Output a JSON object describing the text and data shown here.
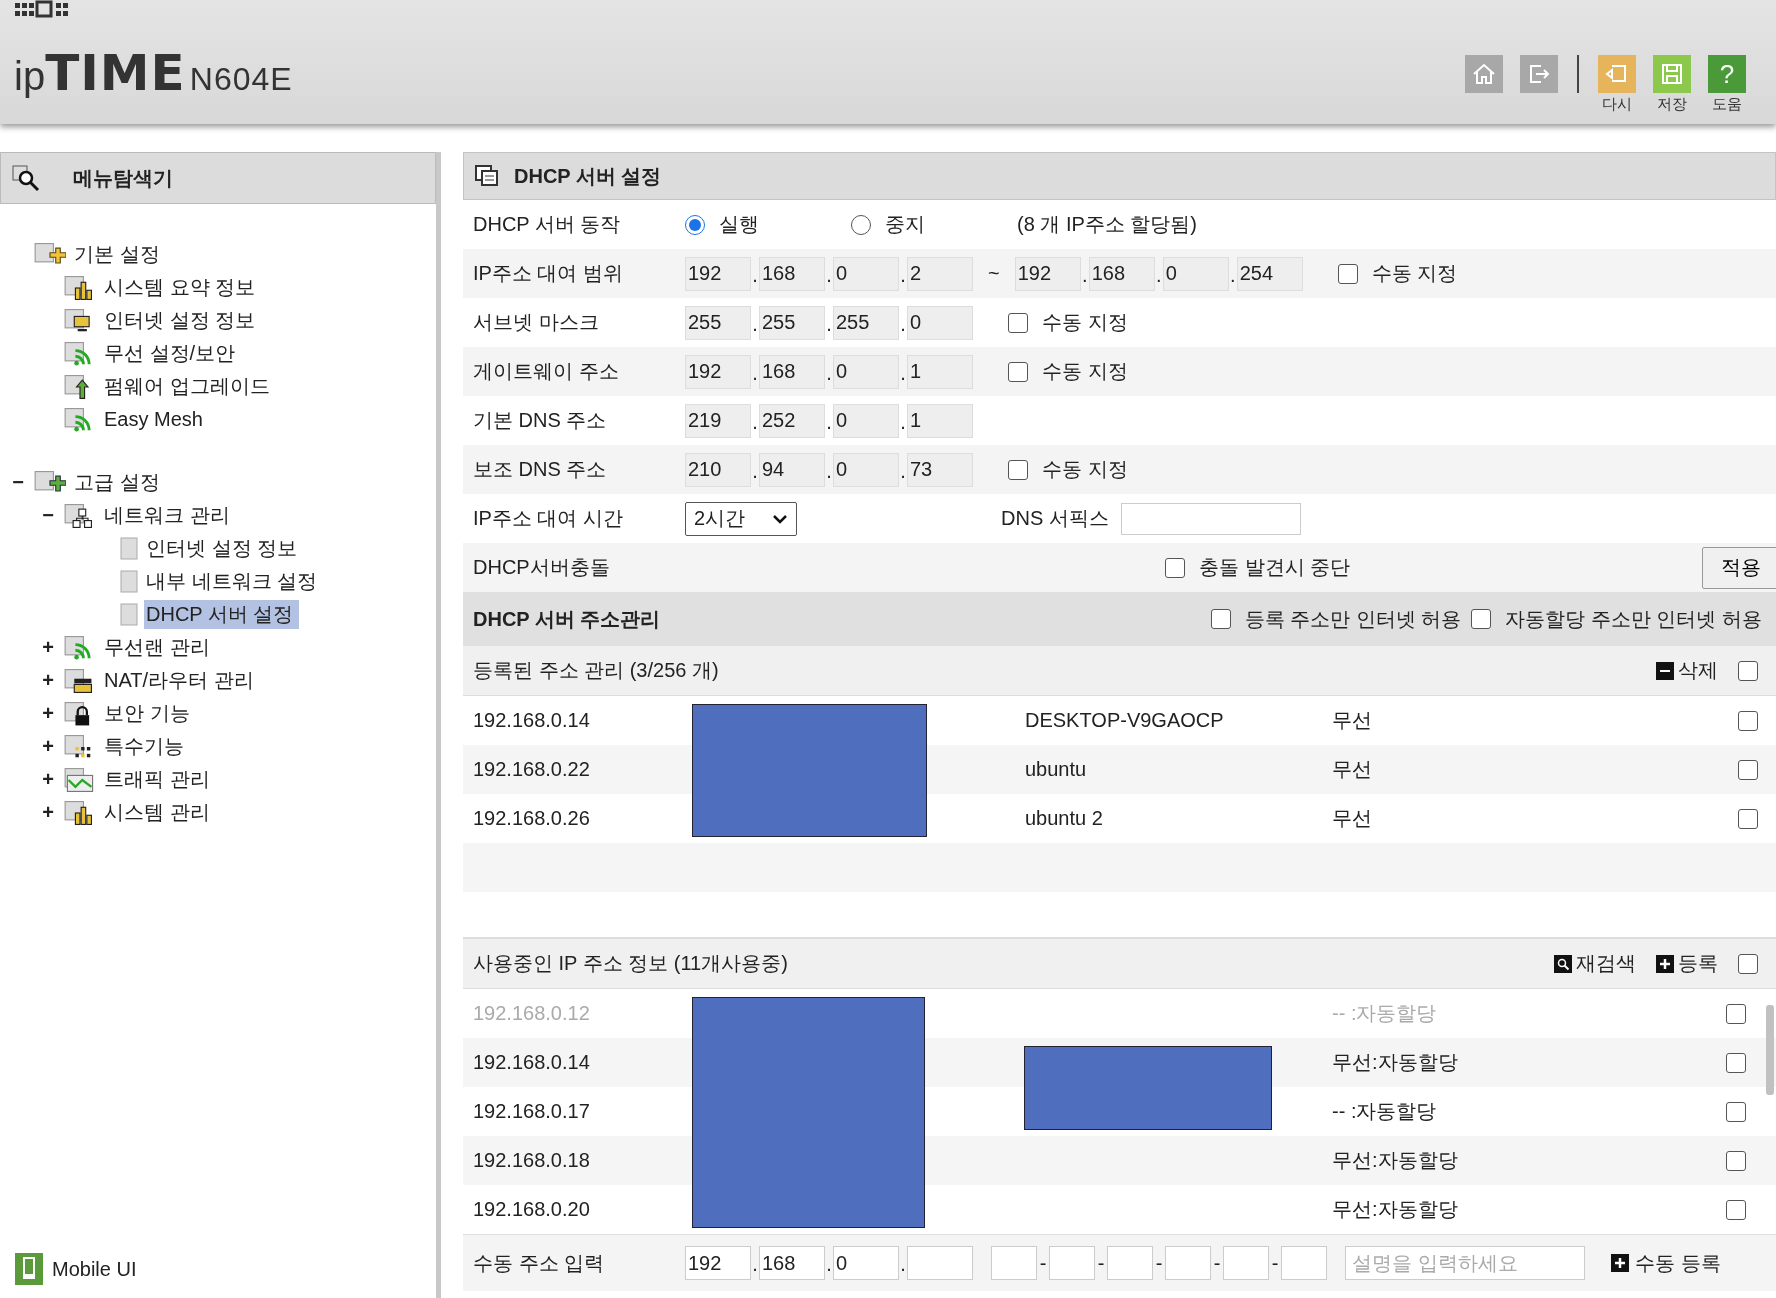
{
  "header": {
    "logo_prefix": "ip",
    "logo_main": "TIME",
    "model": "N604E",
    "toolbar": [
      {
        "kind": "home"
      },
      {
        "kind": "logout"
      },
      {
        "kind": "reload",
        "label": "다시"
      },
      {
        "kind": "save",
        "label": "저장"
      },
      {
        "kind": "help",
        "label": "도움",
        "glyph": "?"
      }
    ]
  },
  "sidebar": {
    "title": "메뉴탐색기",
    "tree": [
      {
        "label": "기본 설정",
        "kind": "folder-star",
        "selected": false,
        "children": [
          {
            "label": "시스템 요약 정보",
            "kind": "chart",
            "selected": false
          },
          {
            "label": "인터넷 설정 정보",
            "kind": "monitor",
            "selected": false
          },
          {
            "label": "무선 설정/보안",
            "kind": "wifi",
            "selected": false
          },
          {
            "label": "펌웨어 업그레이드",
            "kind": "upload",
            "selected": false
          },
          {
            "label": "Easy Mesh",
            "kind": "wifi",
            "selected": false
          }
        ]
      },
      {
        "label": "고급 설정",
        "kind": "folder-plus",
        "expanded": true,
        "selected": false,
        "children": [
          {
            "label": "네트워크 관리",
            "kind": "network",
            "expanded": true,
            "selected": false,
            "children": [
              {
                "label": "인터넷 설정 정보",
                "kind": "blank",
                "selected": false
              },
              {
                "label": "내부 네트워크 설정",
                "kind": "blank",
                "selected": false
              },
              {
                "label": "DHCP 서버 설정",
                "kind": "blank",
                "selected": true
              }
            ]
          },
          {
            "label": "무선랜 관리",
            "kind": "wifi",
            "expanded": false,
            "selected": false
          },
          {
            "label": "NAT/라우터 관리",
            "kind": "router",
            "expanded": false,
            "selected": false
          },
          {
            "label": "보안 기능",
            "kind": "lock",
            "expanded": false,
            "selected": false
          },
          {
            "label": "특수기능",
            "kind": "dots",
            "expanded": false,
            "selected": false
          },
          {
            "label": "트래픽 관리",
            "kind": "graph",
            "expanded": false,
            "selected": false
          },
          {
            "label": "시스템 관리",
            "kind": "chart",
            "expanded": false,
            "selected": false
          }
        ]
      }
    ],
    "footer": {
      "label": "Mobile UI"
    }
  },
  "main": {
    "title": "DHCP 서버 설정",
    "dot": ".",
    "toggles": {
      "expanded": "−",
      "collapsed": "+"
    },
    "form": [
      {
        "kind": "radio",
        "label": "DHCP 서버 동작",
        "options": [
          {
            "label": "실행",
            "selected": true
          },
          {
            "label": "중지",
            "selected": false
          }
        ],
        "note": "(8 개 IP주소 할당됨)"
      },
      {
        "kind": "ip",
        "label": "IP주소 대여 범위",
        "ips": [
          [
            "192",
            "168",
            "0",
            "2"
          ],
          [
            "192",
            "168",
            "0",
            "254"
          ]
        ],
        "separator": "~",
        "manual": {
          "label": "수동 지정",
          "checked": false
        }
      },
      {
        "kind": "ip",
        "label": "서브넷 마스크",
        "ips": [
          [
            "255",
            "255",
            "255",
            "0"
          ]
        ],
        "manual": {
          "label": "수동 지정",
          "checked": false
        }
      },
      {
        "kind": "ip",
        "label": "게이트웨이 주소",
        "ips": [
          [
            "192",
            "168",
            "0",
            "1"
          ]
        ],
        "manual": {
          "label": "수동 지정",
          "checked": false
        }
      },
      {
        "kind": "ip",
        "label": "기본 DNS 주소",
        "ips": [
          [
            "219",
            "252",
            "0",
            "1"
          ]
        ]
      },
      {
        "kind": "ip",
        "label": "보조 DNS 주소",
        "ips": [
          [
            "210",
            "94",
            "0",
            "73"
          ]
        ],
        "manual": {
          "label": "수동 지정",
          "checked": false
        }
      },
      {
        "kind": "select",
        "label": "IP주소 대여 시간",
        "value": "2시간",
        "field_label": "DNS 서픽스"
      },
      {
        "kind": "conflict",
        "label": "DHCP서버충돌",
        "option": {
          "label": "충돌 발견시 중단",
          "checked": false
        },
        "button": "적용"
      }
    ],
    "address_section": {
      "title": "DHCP 서버 주소관리",
      "options": [
        {
          "label": "등록 주소만 인터넷 허용",
          "checked": false
        },
        {
          "label": "자동할당 주소만 인터넷 허용",
          "checked": false
        }
      ]
    },
    "registered": {
      "title": "등록된 주소 관리 (3/256 개)",
      "action": "삭제",
      "all_checked": false,
      "rows": [
        {
          "ip": "192.168.0.14",
          "mac_redacted": true,
          "name": "DESKTOP-V9GAOCP",
          "type": "무선",
          "checked": false
        },
        {
          "ip": "192.168.0.22",
          "mac_redacted": true,
          "name": "ubuntu",
          "type": "무선",
          "checked": false
        },
        {
          "ip": "192.168.0.26",
          "mac_redacted": true,
          "name": "ubuntu 2",
          "type": "무선",
          "checked": false
        }
      ]
    },
    "in_use": {
      "title": "사용중인 IP 주소 정보 (11개사용중)",
      "actions": [
        {
          "kind": "search",
          "label": "재검색"
        },
        {
          "kind": "add",
          "label": "등록"
        }
      ],
      "all_checked": false,
      "rows": [
        {
          "ip": "192.168.0.12",
          "mac_redacted": true,
          "name_redacted": false,
          "status": "-- :자동할당",
          "dimmed": true,
          "checked": false
        },
        {
          "ip": "192.168.0.14",
          "mac_redacted": true,
          "name_redacted": true,
          "status": "무선:자동할당",
          "dimmed": false,
          "checked": false
        },
        {
          "ip": "192.168.0.17",
          "mac_redacted": true,
          "name_redacted": true,
          "status": "-- :자동할당",
          "dimmed": false,
          "checked": false
        },
        {
          "ip": "192.168.0.18",
          "mac_redacted": true,
          "name_redacted": false,
          "status": "무선:자동할당",
          "dimmed": false,
          "checked": false
        },
        {
          "ip": "192.168.0.20",
          "mac_redacted": true,
          "name_redacted": false,
          "status": "무선:자동할당",
          "dimmed": false,
          "checked": false
        }
      ]
    },
    "manual_entry": {
      "label": "수동 주소 입력",
      "octets": [
        "192",
        "168",
        "0"
      ],
      "mac_separator": "-",
      "placeholder": "설명을 입력하세요",
      "button": "수동 등록"
    }
  }
}
